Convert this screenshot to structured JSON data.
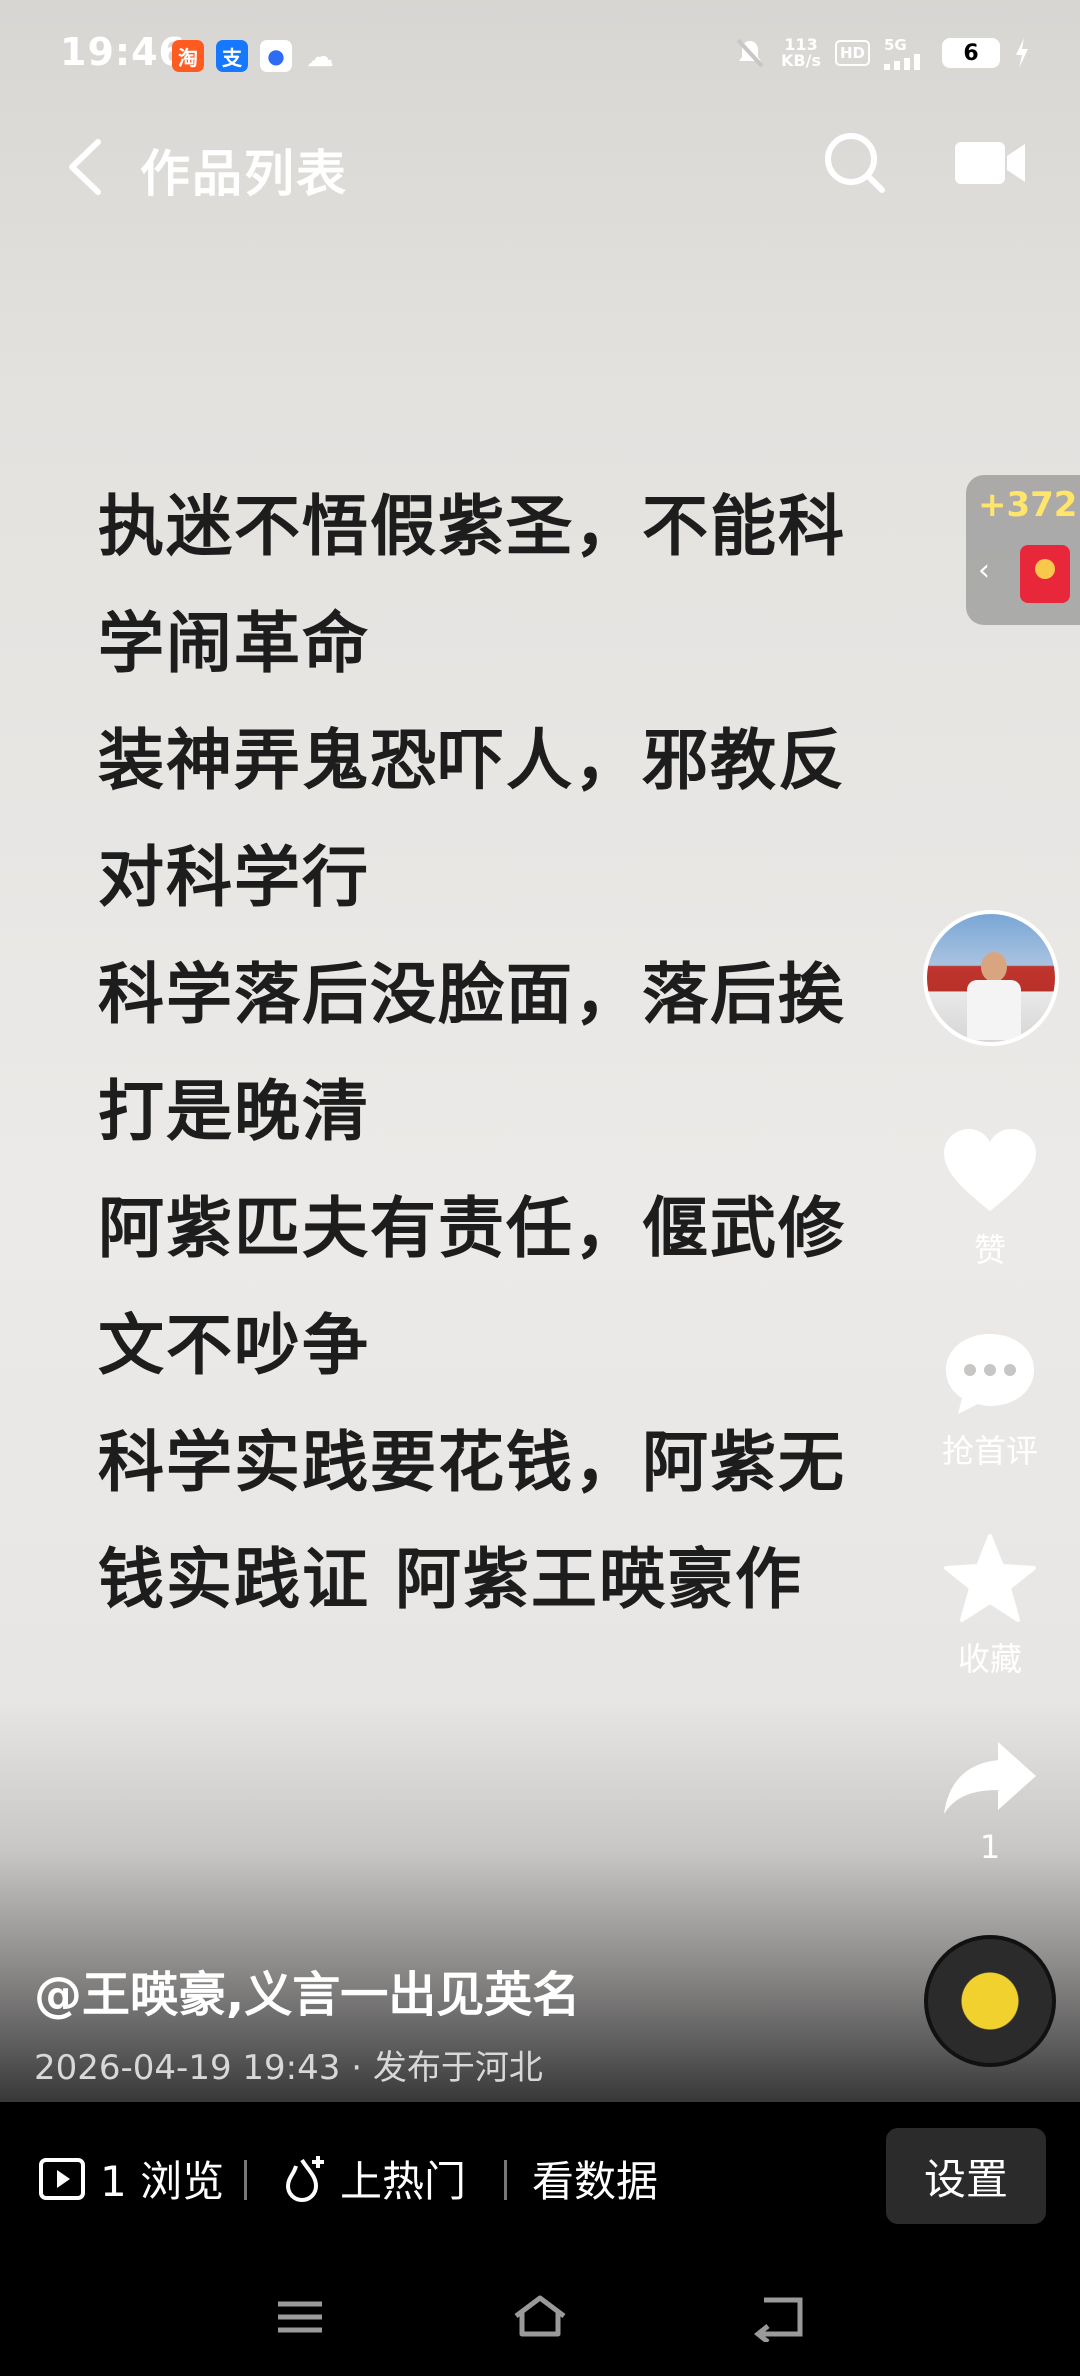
{
  "status_bar": {
    "time": "19:46",
    "net_speed_value": "113",
    "net_speed_unit": "KB/s",
    "hd": "HD",
    "signal": "5G",
    "battery": "6",
    "app_icons": [
      "taobao-icon",
      "alipay-icon",
      "baidu-icon",
      "weather-cloud-icon"
    ]
  },
  "nav": {
    "title": "作品列表"
  },
  "poem": {
    "lines": [
      "执迷不悟假紫圣，不能科",
      "学闹革命",
      "装神弄鬼恐吓人，邪教反",
      "对科学行",
      "科学落后没脸面，落后挨",
      "打是晚清",
      "阿紫匹夫有责任，偃武修",
      "文不吵争",
      "科学实践要花钱，阿紫无",
      "钱实践证  阿紫王暎豪作"
    ]
  },
  "red_packet": {
    "count": "+372"
  },
  "actions": {
    "like_label": "赞",
    "comment_label": "抢首评",
    "collect_label": "收藏",
    "share_count": "1"
  },
  "caption": {
    "author": "@王暎豪,义言一出见英名",
    "datetime": "2026-04-19 19:43",
    "location": "发布于河北"
  },
  "bottom_bar": {
    "views": "1 浏览",
    "boost": "上热门",
    "data": "看数据",
    "settings": "设置"
  },
  "colors": {
    "background": "#e8e6e4",
    "poem_text": "#1d1d1d",
    "red_packet_count": "#ffe66b",
    "bottom_bar": "#000000"
  }
}
